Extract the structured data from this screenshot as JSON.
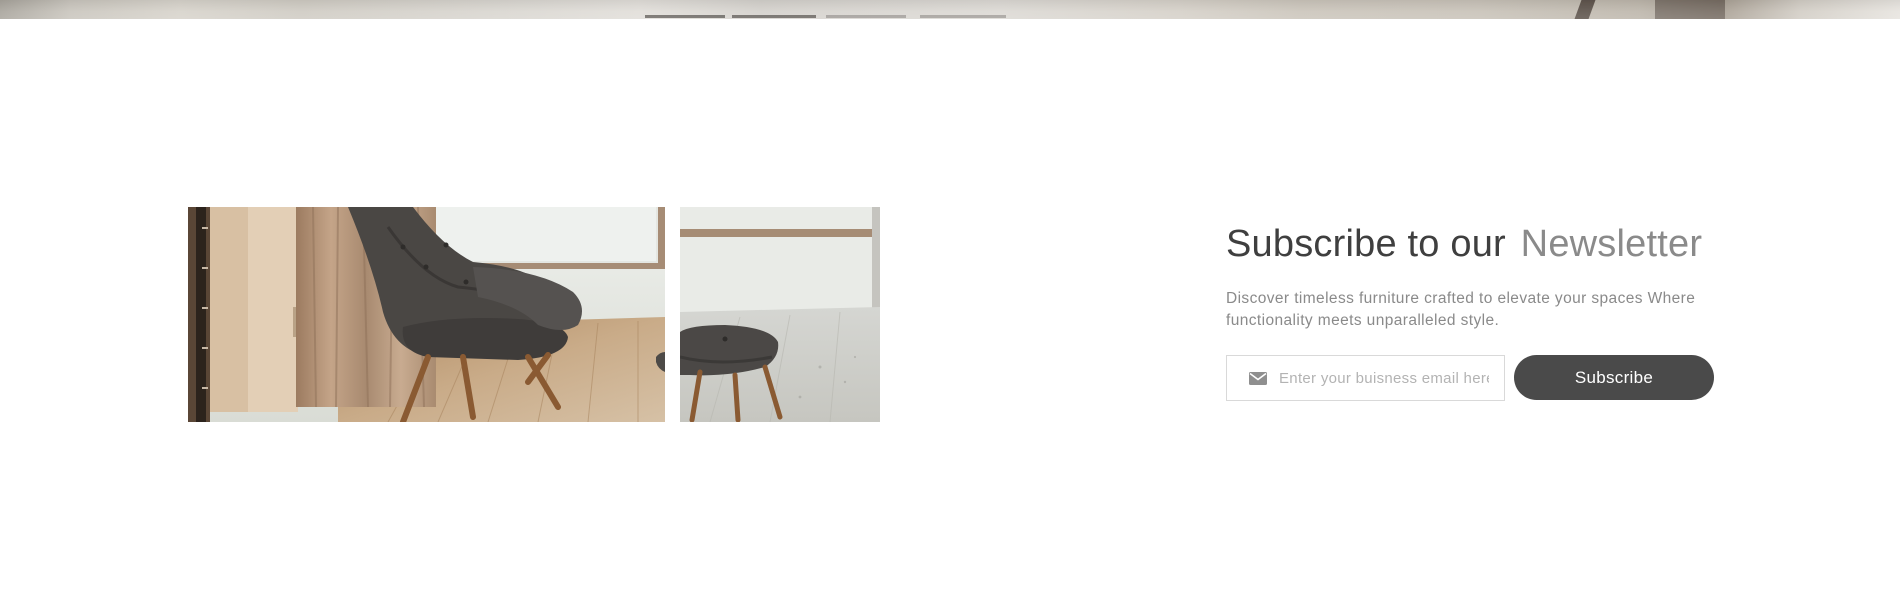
{
  "newsletter": {
    "title_main": "Subscribe to our",
    "title_accent": "Newsletter",
    "description": "Discover timeless furniture crafted to elevate your spaces Where functionality meets unparalleled style.",
    "email_placeholder": "Enter your buisness email here",
    "subscribe_label": "Subscribe"
  },
  "icons": {
    "email": "mail-icon"
  },
  "colors": {
    "title": "#3f3f3f",
    "accent": "#8a8a8a",
    "button_bg": "#4a4a4a",
    "button_text": "#ffffff"
  }
}
